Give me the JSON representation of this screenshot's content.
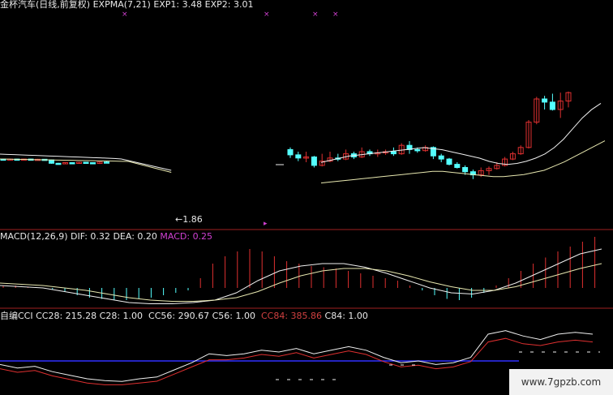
{
  "colors": {
    "up": "#e03030",
    "down": "#54ffff",
    "line_white": "#f0f0f0",
    "line_yellow": "#e8e8b0",
    "magenta": "#d040d0",
    "red": "#d04040",
    "blue": "#3030ff",
    "divider": "#a02020"
  },
  "price_panel": {
    "title": "金杯汽车(日线,前复权)",
    "indicator": "EXPMA(7,21)",
    "exp1": "EXP1: 3.48",
    "exp2": "EXP2: 3.01",
    "low_marker": "←1.86"
  },
  "macd_panel": {
    "name": "MACD(12,26,9)",
    "dif": "DIF: 0.32",
    "dea": "DEA: 0.20",
    "macd": "MACD: 0.25"
  },
  "cci_panel": {
    "name": "自编CCI",
    "cc28": "CC28: 215.28",
    "c28": "C28: 1.00",
    "cc56": "CC56: 290.67",
    "c56": "C56: 1.00",
    "cc84": "CC84: 385.86",
    "c84": "C84: 1.00"
  },
  "watermark": "www.7gpzb.com",
  "chart_data": {
    "type": "candlestick",
    "candles_early": [
      {
        "o": 3,
        "c": 2.5,
        "h": 3.5,
        "l": 2
      },
      {
        "o": 2.5,
        "c": 3,
        "h": 3.5,
        "l": 2
      },
      {
        "o": 3,
        "c": 2.6,
        "h": 3.4,
        "l": 2.2
      },
      {
        "o": 2.6,
        "c": 3,
        "h": 3.3,
        "l": 2.2
      },
      {
        "o": 3,
        "c": 2.5,
        "h": 3.4,
        "l": 2.2
      },
      {
        "o": 2.5,
        "c": 2.8,
        "h": 3.2,
        "l": 2.1
      },
      {
        "o": 2.8,
        "c": 2.2,
        "h": 3.1,
        "l": 1.9
      },
      {
        "o": 2.2,
        "c": -1,
        "h": 2.5,
        "l": -1.4
      },
      {
        "o": -1,
        "c": -1.4,
        "h": -0.6,
        "l": -1.8
      },
      {
        "o": -1.4,
        "c": -0.4,
        "h": 0,
        "l": -1.8
      },
      {
        "o": -0.4,
        "c": -0.8,
        "h": 0,
        "l": -1.2
      },
      {
        "o": -0.8,
        "c": 0,
        "h": 0.4,
        "l": -1.1
      },
      {
        "o": 0,
        "c": -0.4,
        "h": 0.4,
        "l": -0.8
      },
      {
        "o": -0.4,
        "c": -1.2,
        "h": 0,
        "l": -1.6
      },
      {
        "o": -1.2,
        "c": 0.2,
        "h": 0.6,
        "l": -1.6
      },
      {
        "o": 0.2,
        "c": -0.2,
        "h": 1.2,
        "l": -0.6
      }
    ],
    "candles_late": [
      {
        "o": 12,
        "c": 7,
        "h": 14,
        "l": 4
      },
      {
        "o": 7,
        "c": 4,
        "h": 10,
        "l": 1
      },
      {
        "o": 4,
        "c": 5,
        "h": 10,
        "l": 0
      },
      {
        "o": 5,
        "c": -3,
        "h": 6,
        "l": -5
      },
      {
        "o": -3,
        "c": 1,
        "h": 8,
        "l": -4
      },
      {
        "o": 1,
        "c": 4,
        "h": 10,
        "l": 0
      },
      {
        "o": 4,
        "c": 3,
        "h": 8,
        "l": 1
      },
      {
        "o": 3,
        "c": 8,
        "h": 12,
        "l": 2
      },
      {
        "o": 8,
        "c": 5,
        "h": 10,
        "l": 3
      },
      {
        "o": 5,
        "c": 10,
        "h": 14,
        "l": 4
      },
      {
        "o": 10,
        "c": 8,
        "h": 12,
        "l": 6
      },
      {
        "o": 8,
        "c": 9,
        "h": 12,
        "l": 5
      },
      {
        "o": 9,
        "c": 10,
        "h": 12,
        "l": 7
      },
      {
        "o": 10,
        "c": 8,
        "h": 14,
        "l": 6
      },
      {
        "o": 8,
        "c": 16,
        "h": 18,
        "l": 7
      },
      {
        "o": 16,
        "c": 12,
        "h": 20,
        "l": 8
      },
      {
        "o": 12,
        "c": 11,
        "h": 14,
        "l": 9
      },
      {
        "o": 11,
        "c": 14,
        "h": 16,
        "l": 10
      },
      {
        "o": 14,
        "c": 6,
        "h": 15,
        "l": 3
      },
      {
        "o": 6,
        "c": 3,
        "h": 8,
        "l": 0
      },
      {
        "o": 3,
        "c": -2,
        "h": 4,
        "l": -3
      },
      {
        "o": -2,
        "c": -5,
        "h": 0,
        "l": -6
      },
      {
        "o": -5,
        "c": -9,
        "h": -3,
        "l": -12
      },
      {
        "o": -9,
        "c": -12,
        "h": -7,
        "l": -16
      },
      {
        "o": -12,
        "c": -8,
        "h": -5,
        "l": -14
      },
      {
        "o": -8,
        "c": -6,
        "h": -4,
        "l": -12
      },
      {
        "o": -6,
        "c": -3,
        "h": 0,
        "l": -7
      },
      {
        "o": -3,
        "c": 3,
        "h": 5,
        "l": -4
      },
      {
        "o": 3,
        "c": 8,
        "h": 10,
        "l": 2
      },
      {
        "o": 8,
        "c": 14,
        "h": 16,
        "l": 7
      },
      {
        "o": 14,
        "c": 38,
        "h": 40,
        "l": 13
      },
      {
        "o": 38,
        "c": 60,
        "h": 62,
        "l": 36
      },
      {
        "o": 60,
        "c": 57,
        "h": 63,
        "l": 50
      },
      {
        "o": 57,
        "c": 50,
        "h": 65,
        "l": 49
      },
      {
        "o": 50,
        "c": 58,
        "h": 66,
        "l": 42
      },
      {
        "o": 58,
        "c": 66,
        "h": 67,
        "l": 52
      }
    ],
    "exp1_late": [
      -4,
      -2,
      0,
      2,
      3,
      4,
      5,
      6,
      7,
      8,
      9,
      10,
      9,
      8,
      6,
      4,
      2,
      0,
      -3,
      -5,
      -6,
      -5,
      -3,
      0,
      4,
      10,
      18,
      28,
      38,
      46,
      52
    ],
    "exp2_late": [
      -12,
      -11,
      -10,
      -9,
      -8,
      -7,
      -6,
      -5,
      -4,
      -3,
      -2,
      -1,
      -1,
      -2,
      -3,
      -4,
      -5,
      -6,
      -6,
      -5,
      -4,
      -2,
      0,
      4,
      8,
      13,
      18,
      23,
      28
    ],
    "macd_hist": [
      0.02,
      0.02,
      0.01,
      0,
      -0.01,
      -0.03,
      -0.06,
      -0.08,
      -0.09,
      -0.1,
      -0.1,
      -0.09,
      -0.08,
      -0.06,
      -0.04,
      -0.02,
      0.08,
      0.2,
      0.26,
      0.3,
      0.32,
      0.3,
      0.26,
      0.22,
      0.2,
      0.18,
      0.17,
      0.16,
      0.14,
      0.12,
      0.1,
      0.08,
      0.06,
      0.02,
      -0.02,
      -0.06,
      -0.09,
      -0.1,
      -0.08,
      -0.04,
      0.02,
      0.08,
      0.14,
      0.2,
      0.25,
      0.3,
      0.34,
      0.38,
      0.42
    ],
    "macd_dif": [
      0.02,
      0.01,
      0,
      -0.03,
      -0.06,
      -0.09,
      -0.12,
      -0.13,
      -0.13,
      -0.12,
      -0.1,
      -0.04,
      0.06,
      0.14,
      0.18,
      0.2,
      0.2,
      0.17,
      0.12,
      0.06,
      0,
      -0.04,
      -0.05,
      -0.02,
      0.04,
      0.12,
      0.2,
      0.28,
      0.32
    ],
    "macd_dea": [
      0.04,
      0.03,
      0.02,
      0,
      -0.02,
      -0.05,
      -0.08,
      -0.1,
      -0.11,
      -0.11,
      -0.1,
      -0.08,
      -0.03,
      0.04,
      0.1,
      0.14,
      0.16,
      0.16,
      0.14,
      0.1,
      0.05,
      0.01,
      -0.02,
      -0.02,
      0.01,
      0.06,
      0.11,
      0.16,
      0.2
    ],
    "cci_white": [
      -20,
      -40,
      -30,
      -60,
      -80,
      -100,
      -110,
      -115,
      -100,
      -90,
      -50,
      -10,
      40,
      30,
      40,
      60,
      50,
      70,
      40,
      60,
      80,
      60,
      20,
      -10,
      0,
      -20,
      -10,
      20,
      150,
      170,
      140,
      120,
      150,
      160,
      150
    ],
    "cci_red": [
      -30,
      -50,
      -40,
      -70,
      -90,
      -110,
      -120,
      -120,
      -110,
      -100,
      -60,
      -20,
      20,
      20,
      30,
      50,
      40,
      60,
      30,
      50,
      70,
      50,
      10,
      -20,
      -10,
      -30,
      -20,
      10,
      120,
      140,
      110,
      100,
      120,
      130,
      120
    ],
    "cci_blue_level": 0
  }
}
